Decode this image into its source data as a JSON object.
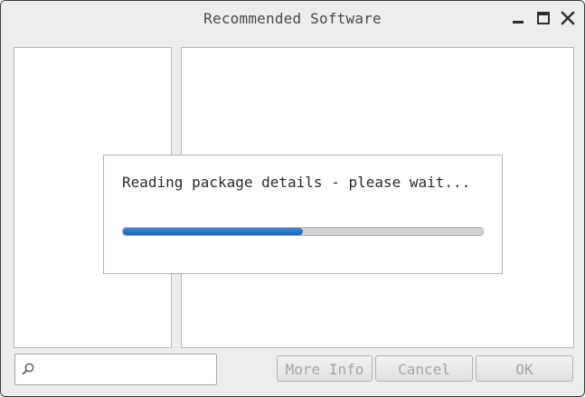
{
  "window": {
    "title": "Recommended Software",
    "controls": [
      "minimize-icon",
      "maximize-icon",
      "close-icon"
    ]
  },
  "dialog": {
    "message": "Reading package details - please wait...",
    "progress": 0.5,
    "progress_color": "#2a72c8"
  },
  "search": {
    "icon": "search-icon",
    "value": "",
    "placeholder": ""
  },
  "buttons": {
    "more_info": "More Info",
    "cancel": "Cancel",
    "ok": "OK"
  }
}
